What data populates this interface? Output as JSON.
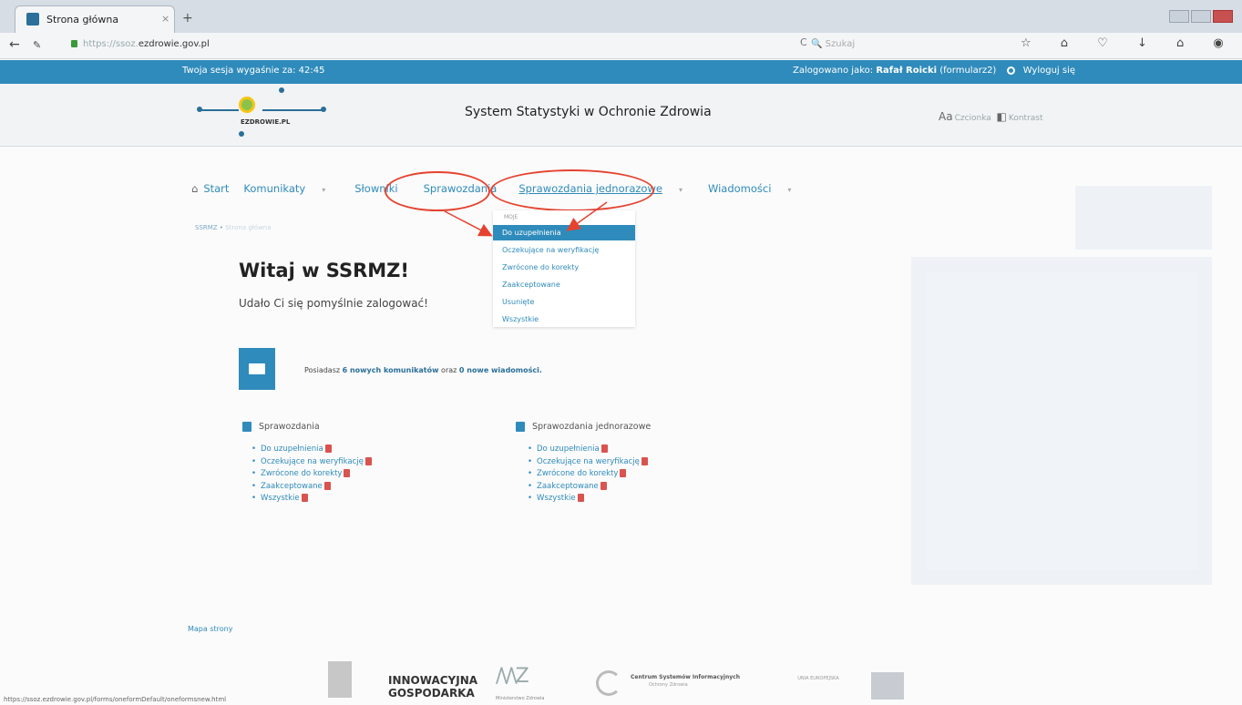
{
  "browser": {
    "tab_title": "Strona główna",
    "tab_close": "×",
    "new_tab": "+",
    "url_scheme": "https://",
    "url_faint": "ssoz.",
    "url_host": "ezdrowie.gov.pl",
    "reload": "C",
    "search_placeholder": "Szukaj",
    "back": "←",
    "toolbar_glyphs": "☆ ⌂ ♡ ↓ ⌂ ◉ ≡",
    "status_url": "https://ssoz.ezdrowie.gov.pl/forms/oneformDefault/oneformsnew.html"
  },
  "session": {
    "expires_label": "Twoja sesja wygaśnie za:",
    "expires_time": "42:45",
    "logged_as_label": "Zalogowano jako:",
    "user_name": "Rafał Roicki",
    "user_login": "(formularz2)",
    "logout": "Wyloguj się"
  },
  "header": {
    "logo_text": "EZDROWIE.PL",
    "system_title": "System Statystyki w Ochronie Zdrowia",
    "font_label": "Czcionka",
    "contrast_label": "Kontrast"
  },
  "menu": {
    "start": "Start",
    "komunikaty": "Komunikaty",
    "slowniki": "Słowniki",
    "sprawozdania": "Sprawozdania",
    "sprawozdania_jednorazowe": "Sprawozdania jednorazowe",
    "wiadomosci": "Wiadomości",
    "dropdown_arrow": "▾"
  },
  "breadcrumb": {
    "root": "SSRMZ",
    "sep": "•",
    "current": "Strona główna"
  },
  "dropdown": {
    "header": "MOJE",
    "items": [
      "Do uzupełnienia",
      "Oczekujące na weryfikację",
      "Zwrócone do korekty",
      "Zaakceptowane",
      "Usunięte",
      "Wszystkie"
    ]
  },
  "main": {
    "welcome": "Witaj w SSRMZ!",
    "welcome_sub": "Udało Ci się pomyślnie zalogować!",
    "msg_pre": "Posiadasz",
    "msg_new_comms": "6 nowych komunikatów",
    "msg_mid": "oraz",
    "msg_new_msgs": "0 nowe wiadomości."
  },
  "sections": {
    "left": {
      "title": "Sprawozdania",
      "items": [
        "Do uzupełnienia",
        "Oczekujące na weryfikację",
        "Zwrócone do korekty",
        "Zaakceptowane",
        "Wszystkie"
      ]
    },
    "right": {
      "title": "Sprawozdania jednorazowe",
      "items": [
        "Do uzupełnienia",
        "Oczekujące na weryfikację",
        "Zwrócone do korekty",
        "Zaakceptowane",
        "Wszystkie"
      ]
    }
  },
  "footer": {
    "sitemap": "Mapa strony",
    "innow_1": "INNOWACYJNA",
    "innow_2": "GOSPODARKA",
    "mz": "Ministerstwo Zdrowia",
    "csi": "Centrum Systemów Informacyjnych",
    "csi_2": "Ochrony Zdrowia",
    "ue": "UNIA EUROPEJSKA"
  },
  "colors": {
    "accent": "#2f8bbb",
    "annotation": "#e5432f",
    "badge": "#d9534f"
  }
}
